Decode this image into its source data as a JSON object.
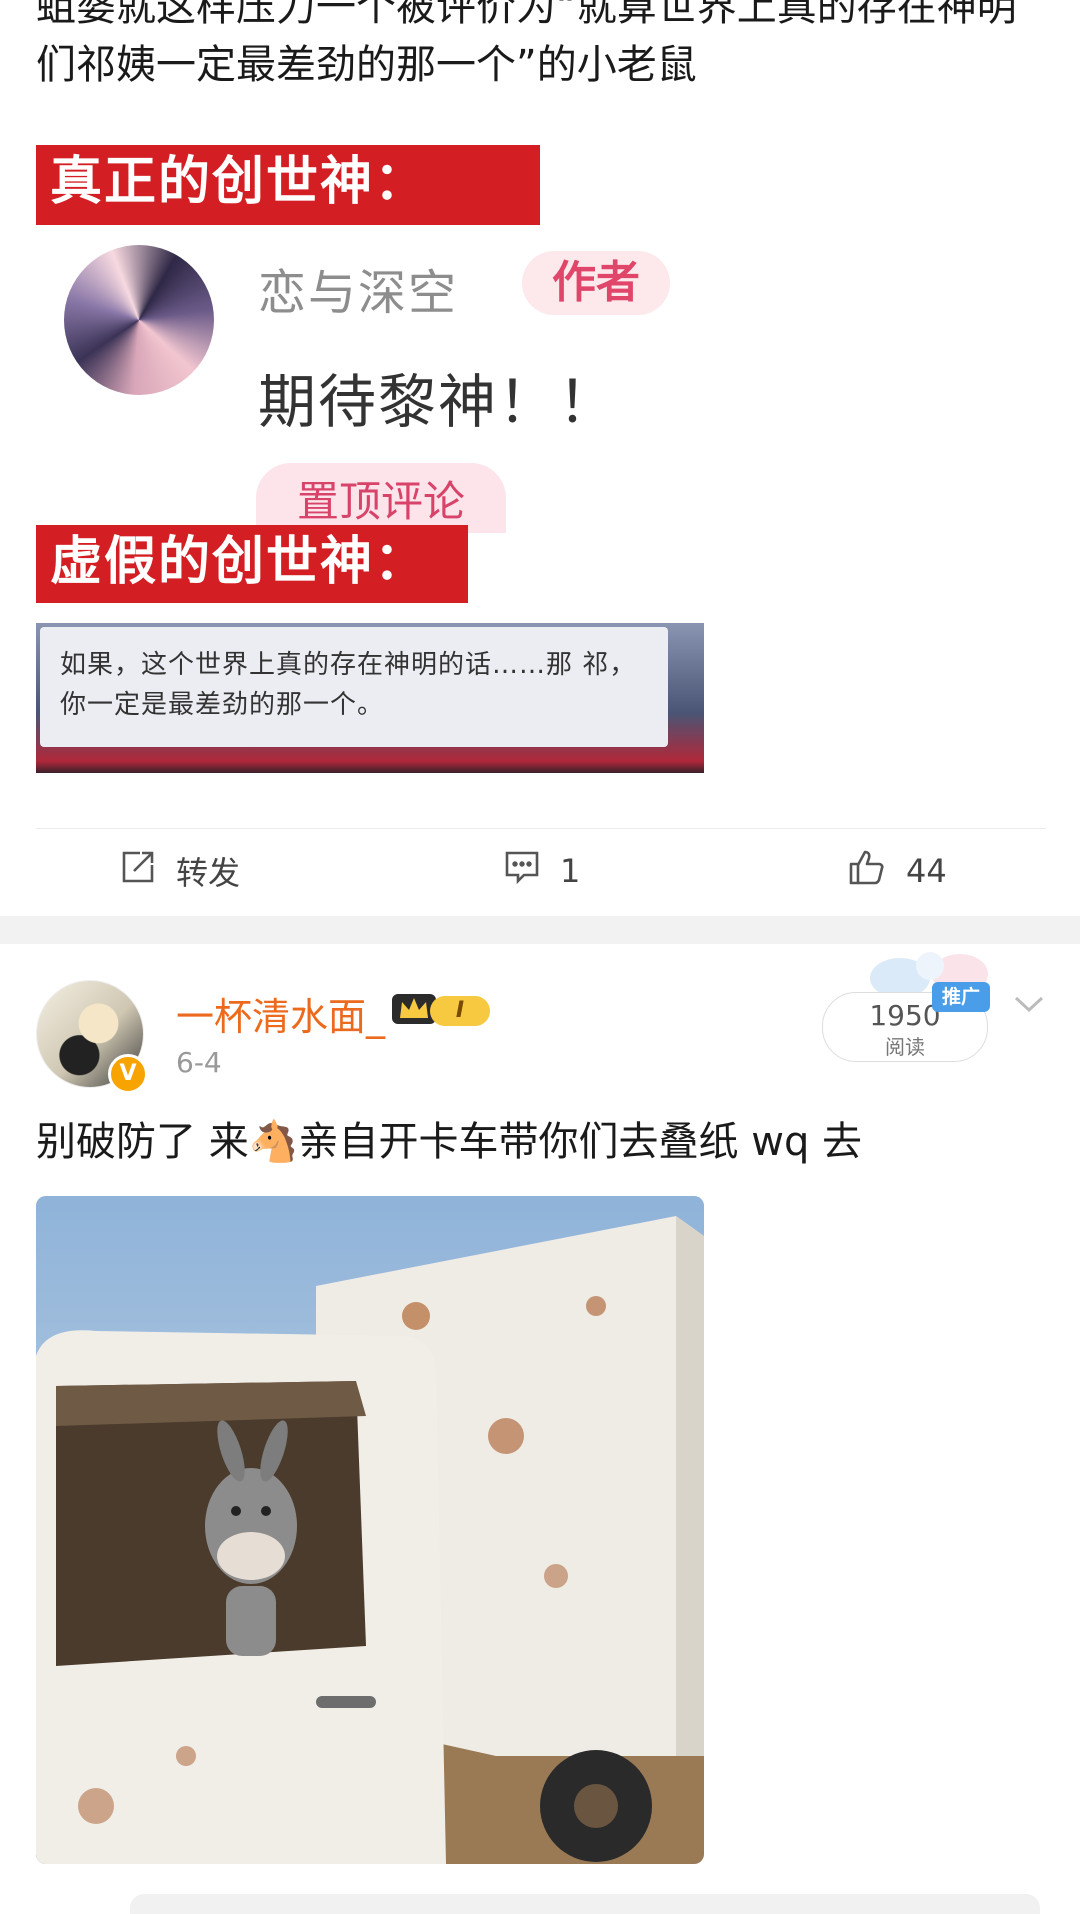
{
  "post1": {
    "text": "蛆婆就这样压力一个被评价为“就算世界上真的存在神明 们祁姨一定最差劲的那一个”的小老鼠",
    "meme": {
      "banner_real": "真正的创世神：",
      "comment_author": "恋与深空",
      "author_tag": "作者",
      "comment_text": "期待黎神！！",
      "pinned_label": "置顶评论",
      "banner_fake": "虚假的创世神：",
      "dialog_text": "如果，这个世界上真的存在神明的话……那 祁，你一定是最差劲的那一个。"
    },
    "actions": {
      "repost_label": "转发",
      "comment_count": "1",
      "like_count": "44"
    }
  },
  "post2": {
    "username": "一杯清水面_",
    "level_badge": "I",
    "time": "6-4",
    "reads_count": "1950",
    "reads_label": "阅读",
    "promo_label": "推广",
    "text": "别破防了 来🐴亲自开卡车带你们去叠纸 wq 去",
    "verified_mark": "V"
  },
  "colors": {
    "banner_red": "#d31f23",
    "username_orange": "#ec6a1e",
    "promo_blue": "#4a9de8",
    "verified_gold": "#f7a400"
  }
}
